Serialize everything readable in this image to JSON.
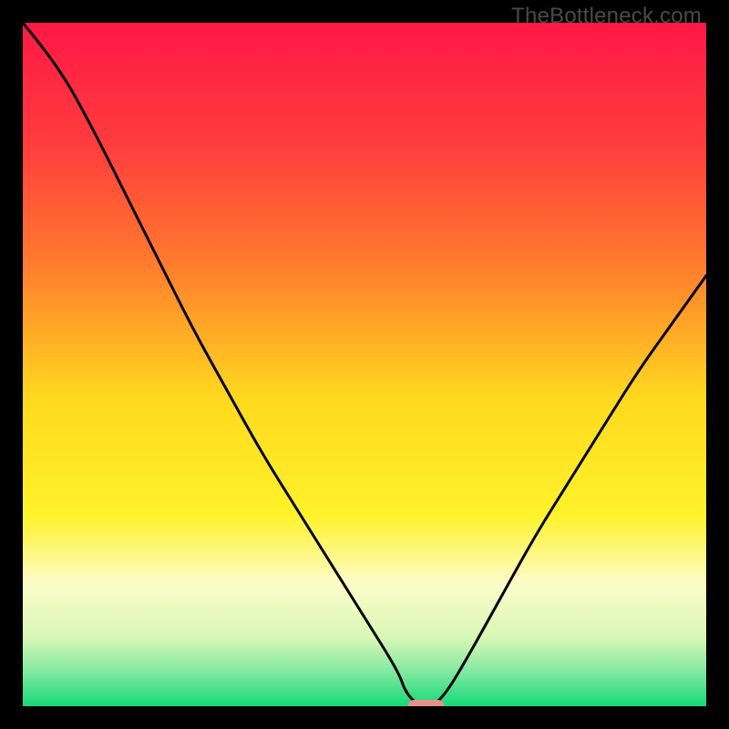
{
  "watermark": "TheBottleneck.com",
  "chart_data": {
    "type": "line",
    "title": "",
    "xlabel": "",
    "ylabel": "",
    "xlim": [
      0,
      100
    ],
    "ylim": [
      0,
      100
    ],
    "grid": false,
    "legend": false,
    "annotations": [],
    "series": [
      {
        "name": "bottleneck-curve",
        "x": [
          0,
          5,
          10,
          15,
          20,
          25,
          30,
          35,
          40,
          45,
          50,
          55,
          56,
          58,
          60,
          62,
          65,
          70,
          75,
          80,
          85,
          90,
          95,
          100
        ],
        "y": [
          100,
          94,
          85,
          75,
          65,
          55,
          46,
          37,
          29,
          21,
          13,
          5,
          2,
          0,
          0,
          2,
          7,
          16,
          25,
          33,
          41,
          49,
          56,
          63
        ]
      }
    ],
    "marker": {
      "name": "optimal-point",
      "x": 59,
      "y": 0,
      "color": "#e88f88",
      "shape": "pill"
    },
    "background_gradient": {
      "stops": [
        {
          "offset": 0.0,
          "color": "#ff1846"
        },
        {
          "offset": 0.18,
          "color": "#ff3d3d"
        },
        {
          "offset": 0.35,
          "color": "#ff7a2e"
        },
        {
          "offset": 0.55,
          "color": "#ffd91f"
        },
        {
          "offset": 0.72,
          "color": "#fff22a"
        },
        {
          "offset": 0.82,
          "color": "#fdfcc8"
        },
        {
          "offset": 0.9,
          "color": "#d8f7b6"
        },
        {
          "offset": 0.95,
          "color": "#80e9a0"
        },
        {
          "offset": 1.0,
          "color": "#17d877"
        }
      ]
    }
  }
}
